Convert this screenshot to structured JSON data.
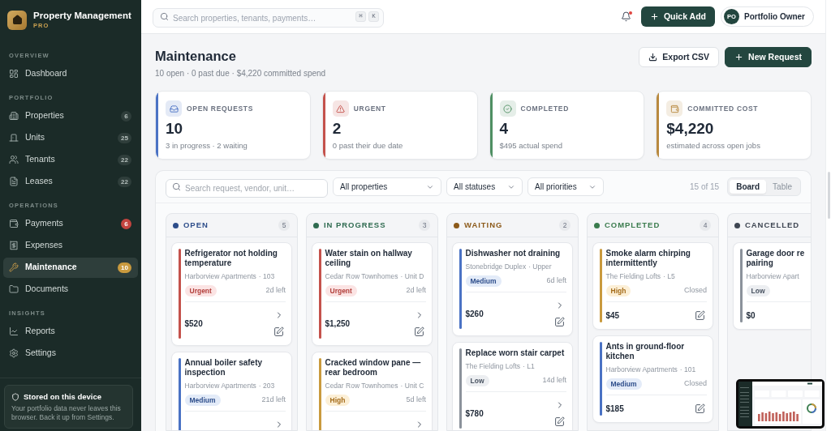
{
  "sidebar": {
    "brand": {
      "name": "Property Management",
      "tier": "PRO"
    },
    "sections": [
      {
        "title": "OVERVIEW",
        "items": [
          {
            "label": "Dashboard",
            "selected": false
          }
        ]
      },
      {
        "title": "PORTFOLIO",
        "items": [
          {
            "label": "Properties",
            "selected": false,
            "badge": {
              "text": "6",
              "alert": false
            }
          },
          {
            "label": "Units",
            "selected": false,
            "badge": {
              "text": "25",
              "alert": false
            }
          },
          {
            "label": "Tenants",
            "selected": false,
            "badge": {
              "text": "22",
              "alert": false
            }
          },
          {
            "label": "Leases",
            "selected": false,
            "badge": {
              "text": "22",
              "alert": false
            }
          }
        ]
      },
      {
        "title": "OPERATIONS",
        "items": [
          {
            "label": "Payments",
            "selected": false,
            "badge": {
              "text": "6",
              "alert": true
            }
          },
          {
            "label": "Expenses",
            "selected": false
          },
          {
            "label": "Maintenance",
            "selected": true,
            "badge": {
              "text": "10",
              "alert": false
            }
          },
          {
            "label": "Documents",
            "selected": false
          }
        ]
      },
      {
        "title": "INSIGHTS",
        "items": [
          {
            "label": "Reports",
            "selected": false
          },
          {
            "label": "Settings",
            "selected": false
          }
        ]
      }
    ],
    "notice": {
      "title": "Stored on this device",
      "body": "Your portfolio data never leaves this browser. Back it up from Settings."
    }
  },
  "topbar": {
    "search": {
      "placeholder": "Search properties, tenants, payments…",
      "keys": [
        "⌘",
        "K"
      ]
    },
    "notifications": {
      "unread": true
    },
    "quick_add": "Quick Add",
    "user": {
      "initials": "PO",
      "name": "Portfolio Owner"
    }
  },
  "header": {
    "title": "Maintenance",
    "subtitle": "10 open · 0 past due · $4,220 committed spend",
    "actions": [
      {
        "label": "Export CSV",
        "kind": "export"
      },
      {
        "label": "New Request",
        "kind": "create"
      }
    ]
  },
  "stats": [
    {
      "label": "OPEN REQUESTS",
      "value": "10",
      "note": "3 in progress · 2 waiting",
      "color": "#4a72c4"
    },
    {
      "label": "URGENT",
      "value": "2",
      "note": "0 past their due date",
      "color": "#c4524c"
    },
    {
      "label": "COMPLETED",
      "value": "4",
      "note": "$495 actual spend",
      "color": "#4f8f63"
    },
    {
      "label": "COMMITTED COST",
      "value": "$4,220",
      "note": "estimated across open jobs",
      "color": "#b8893f"
    }
  ],
  "board": {
    "search": {
      "placeholder": "Search request, vendor, unit…"
    },
    "filters": [
      {
        "value": "All properties"
      },
      {
        "value": "All statuses"
      },
      {
        "value": "All priorities"
      }
    ],
    "result_count": "15 of 15",
    "views": [
      {
        "label": "Board",
        "selected": true
      },
      {
        "label": "Table",
        "selected": false
      }
    ],
    "columns": [
      {
        "title": "OPEN",
        "count": "5",
        "color": "#2d4d8a",
        "cards": [
          {
            "title": "Refrigerator not holding temperature",
            "location": "Harborview Apartments",
            "unit": "· 103",
            "priority": {
              "label": "Urgent",
              "kind": "urgent"
            },
            "due": "2d left",
            "price": "$520",
            "advance": true,
            "edit": true
          },
          {
            "title": "Annual boiler safety inspection",
            "location": "Harborview Apartments",
            "unit": "· 203",
            "priority": {
              "label": "Medium",
              "kind": "medium"
            },
            "due": "21d left",
            "advance": true,
            "edit": false
          }
        ]
      },
      {
        "title": "IN PROGRESS",
        "count": "3",
        "color": "#2f6b50",
        "cards": [
          {
            "title": "Water stain on hallway ceiling",
            "location": "Cedar Row Townhomes",
            "unit": "· Unit D",
            "priority": {
              "label": "Urgent",
              "kind": "urgent"
            },
            "due": "2d left",
            "price": "$1,250",
            "advance": true,
            "edit": true
          },
          {
            "title": "Cracked window pane — rear bedroom",
            "location": "Cedar Row Townhomes",
            "unit": "· Unit C",
            "priority": {
              "label": "High",
              "kind": "high"
            },
            "due": "5d left",
            "advance": true,
            "edit": false
          }
        ]
      },
      {
        "title": "WAITING",
        "count": "2",
        "color": "#8c5a1a",
        "cards": [
          {
            "title": "Dishwasher not draining",
            "location": "Stonebridge Duplex",
            "unit": "· Upper",
            "priority": {
              "label": "Medium",
              "kind": "medium"
            },
            "due": "6d left",
            "price": "$260",
            "advance": true,
            "edit": true
          },
          {
            "title": "Replace worn stair carpet",
            "location": "The Fielding Lofts",
            "unit": "· L1",
            "priority": {
              "label": "Low",
              "kind": "low"
            },
            "due": "14d left",
            "price": "$780",
            "advance": true,
            "edit": true
          }
        ]
      },
      {
        "title": "COMPLETED",
        "count": "4",
        "color": "#3a7b4d",
        "cards": [
          {
            "title": "Smoke alarm chirping intermittently",
            "location": "The Fielding Lofts",
            "unit": "· L5",
            "priority": {
              "label": "High",
              "kind": "high"
            },
            "due": "Closed",
            "price": "$45",
            "advance": false,
            "edit": true
          },
          {
            "title": "Ants in ground-floor kitchen",
            "location": "Harborview Apartments",
            "unit": "· 101",
            "priority": {
              "label": "Medium",
              "kind": "medium"
            },
            "due": "Closed",
            "price": "$185",
            "advance": false,
            "edit": true
          }
        ]
      },
      {
        "title": "CANCELLED",
        "color": "#3e4652",
        "cards": [
          {
            "title": "Garage door re pairing",
            "location": "Harborview Apart",
            "priority": {
              "label": "Low",
              "kind": "low"
            },
            "price": "$0",
            "advance": false,
            "edit": false
          }
        ]
      }
    ]
  }
}
